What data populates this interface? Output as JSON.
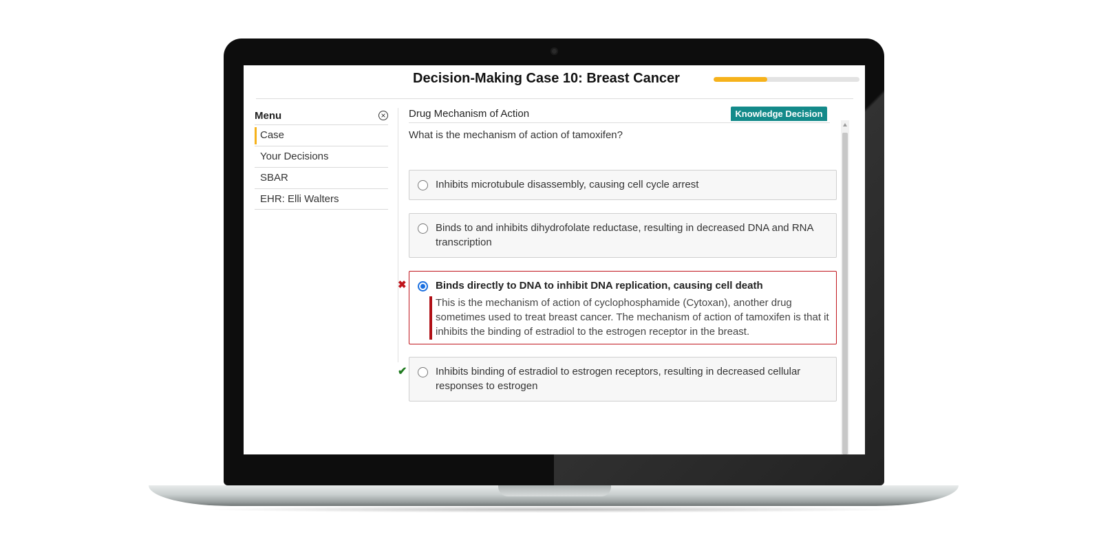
{
  "app": {
    "title": "Decision-Making Case 10: Breast Cancer",
    "progress_fraction": 0.37
  },
  "sidebar": {
    "title": "Menu",
    "close_icon": "close-circle-icon",
    "items": [
      {
        "label": "Case",
        "active": true
      },
      {
        "label": "Your Decisions",
        "active": false
      },
      {
        "label": "SBAR",
        "active": false
      },
      {
        "label": "EHR: Elli Walters",
        "active": false
      }
    ]
  },
  "main": {
    "section_title": "Drug Mechanism of Action",
    "badge": "Knowledge Decision",
    "question": "What is the mechanism of action of tamoxifen?",
    "options": [
      {
        "text": "Inhibits microtubule disassembly, causing cell cycle arrest",
        "selected": false,
        "mark": ""
      },
      {
        "text": "Binds to and inhibits dihydrofolate reductase, resulting in decreased DNA and RNA transcription",
        "selected": false,
        "mark": ""
      },
      {
        "text": "Binds directly to DNA to inhibit DNA replication, causing cell death",
        "selected": true,
        "mark": "incorrect",
        "feedback": "This is the mechanism of action of cyclophosphamide (Cytoxan), another drug sometimes used to treat breast cancer. The mechanism of action of tamoxifen is that it inhibits the binding of estradiol to the estrogen receptor in the breast."
      },
      {
        "text": "Inhibits binding of estradiol to estrogen receptors, resulting in decreased cellular responses to estrogen",
        "selected": false,
        "mark": "correct"
      }
    ],
    "marks": {
      "incorrect": "✖",
      "correct": "✔"
    }
  },
  "colors": {
    "accent": "#f6b21b",
    "badge": "#138a8a",
    "incorrect": "#c0141b",
    "correct": "#1f7a1f",
    "radio_selected": "#1a6fe0"
  }
}
